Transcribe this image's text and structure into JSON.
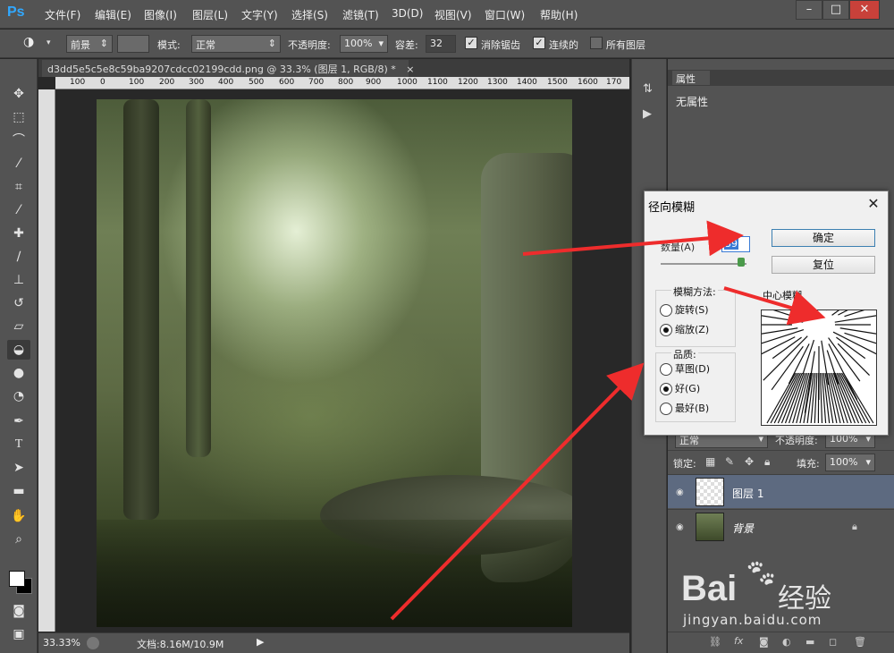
{
  "menubar": {
    "logo": "Ps",
    "items": [
      "文件(F)",
      "编辑(E)",
      "图像(I)",
      "图层(L)",
      "文字(Y)",
      "选择(S)",
      "滤镜(T)",
      "3D(D)",
      "视图(V)",
      "窗口(W)",
      "帮助(H)"
    ],
    "minimize": "–",
    "restore": "□",
    "close": "✕"
  },
  "options": {
    "fill_source": "前景",
    "mode_label": "模式:",
    "mode_value": "正常",
    "opacity_label": "不透明度:",
    "opacity_value": "100%",
    "tolerance_label": "容差:",
    "tolerance_value": "32",
    "antialias_label": "消除锯齿",
    "contiguous_label": "连续的",
    "all_layers_label": "所有图层"
  },
  "document": {
    "tab_title": "d3dd5e5c5e8c59ba9207cdcc02199cdd.png @ 33.3% (图层 1, RGB/8) *",
    "tab_close": "×",
    "ruler_ticks": [
      "100",
      "0",
      "100",
      "200",
      "300",
      "400",
      "500",
      "600",
      "700",
      "800",
      "900",
      "1000",
      "1100",
      "1200",
      "1300",
      "1400",
      "1500",
      "1600",
      "170"
    ],
    "zoom": "33.33%",
    "doc_info": "文档:8.16M/10.9M"
  },
  "properties": {
    "tab": "属性",
    "content": "无属性"
  },
  "layers": {
    "blend_mode": "正常",
    "opacity_label": "不透明度:",
    "opacity_value": "100%",
    "lock_label": "锁定:",
    "fill_label": "填充:",
    "fill_value": "100%",
    "items": [
      {
        "name": "图层 1",
        "selected": true
      },
      {
        "name": "背景",
        "selected": false,
        "locked": true
      }
    ]
  },
  "dialog": {
    "title": "径向模糊",
    "amount_label": "数量(A)",
    "amount_value": "39",
    "ok": "确定",
    "reset": "复位",
    "method_title": "模糊方法:",
    "method_options": [
      "旋转(S)",
      "缩放(Z)"
    ],
    "method_selected": "缩放(Z)",
    "quality_title": "品质:",
    "quality_options": [
      "草图(D)",
      "好(G)",
      "最好(B)"
    ],
    "quality_selected": "好(G)",
    "center_label": "中心模糊"
  },
  "watermark": {
    "brand": "Bai",
    "brand2": "经验",
    "url": "jingyan.baidu.com"
  },
  "colors": {
    "ui_panel": "#535353",
    "ui_dark": "#282828",
    "selected_layer": "#5d6a80",
    "arrow": "#ee2c2c",
    "ps_blue": "#31a8ff"
  }
}
